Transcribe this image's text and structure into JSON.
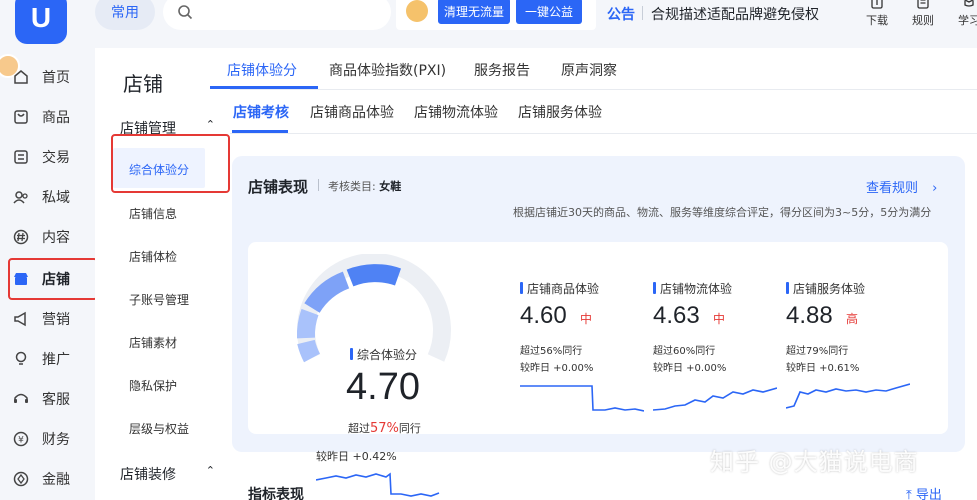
{
  "topbar": {
    "logo_text": "U",
    "common_label": "常用",
    "search_placeholder": "",
    "promo": {
      "btn1": "清理无流量",
      "btn2": "一键公益"
    },
    "notice_label": "公告",
    "notice_text": "合规描述适配品牌避免侵权",
    "actions": [
      {
        "label": "下载",
        "icon": "download-icon"
      },
      {
        "label": "规则",
        "icon": "rules-icon"
      },
      {
        "label": "学习",
        "icon": "learn-icon"
      }
    ]
  },
  "sidebar": {
    "items": [
      {
        "label": "首页",
        "icon": "home-icon"
      },
      {
        "label": "商品",
        "icon": "goods-icon"
      },
      {
        "label": "交易",
        "icon": "trade-icon"
      },
      {
        "label": "私域",
        "icon": "private-icon"
      },
      {
        "label": "内容",
        "icon": "content-icon"
      },
      {
        "label": "店铺",
        "icon": "store-icon"
      },
      {
        "label": "营销",
        "icon": "marketing-icon"
      },
      {
        "label": "推广",
        "icon": "promote-icon"
      },
      {
        "label": "客服",
        "icon": "service-icon"
      },
      {
        "label": "财务",
        "icon": "finance-icon"
      },
      {
        "label": "金融",
        "icon": "loan-icon"
      }
    ],
    "active": "店铺"
  },
  "subnav": {
    "title": "店铺",
    "group1": "店铺管理",
    "items": [
      "综合体验分",
      "店铺信息",
      "店铺体检",
      "子账号管理",
      "店铺素材",
      "隐私保护",
      "层级与权益"
    ],
    "group2": "店铺装修"
  },
  "tabs_primary": [
    "店铺体验分",
    "商品体验指数(PXI)",
    "服务报告",
    "原声洞察"
  ],
  "tabs_secondary": [
    "店铺考核",
    "店铺商品体验",
    "店铺物流体验",
    "店铺服务体验"
  ],
  "card": {
    "title": "店铺表现",
    "category_label": "考核类目:",
    "category_value": "女鞋",
    "link": "查看规则",
    "description": "根据店铺近30天的商品、物流、服务等维度综合评定，得分区间为3~5分，5分为满分",
    "overall": {
      "label": "综合体验分",
      "score": "4.70",
      "exceed_prefix": "超过",
      "exceed_pct": "57%",
      "exceed_suffix": "同行",
      "change": "较昨日 +0.42%",
      "gauge_fraction": 0.7
    },
    "metrics": [
      {
        "title": "店铺商品体验",
        "score": "4.60",
        "level": "中",
        "exceed": "超过56%同行",
        "change": "较昨日 +0.00%"
      },
      {
        "title": "店铺物流体验",
        "score": "4.63",
        "level": "中",
        "exceed": "超过60%同行",
        "change": "较昨日 +0.00%"
      },
      {
        "title": "店铺服务体验",
        "score": "4.88",
        "level": "高",
        "exceed": "超过79%同行",
        "change": "较昨日 +0.61%"
      }
    ]
  },
  "section2": {
    "title": "指标表现",
    "export": "导出"
  },
  "watermark": "知乎 @大猫说电商",
  "colors": {
    "accent": "#2b66f6",
    "danger": "#e53935",
    "card_bg": "#eef3fd"
  }
}
